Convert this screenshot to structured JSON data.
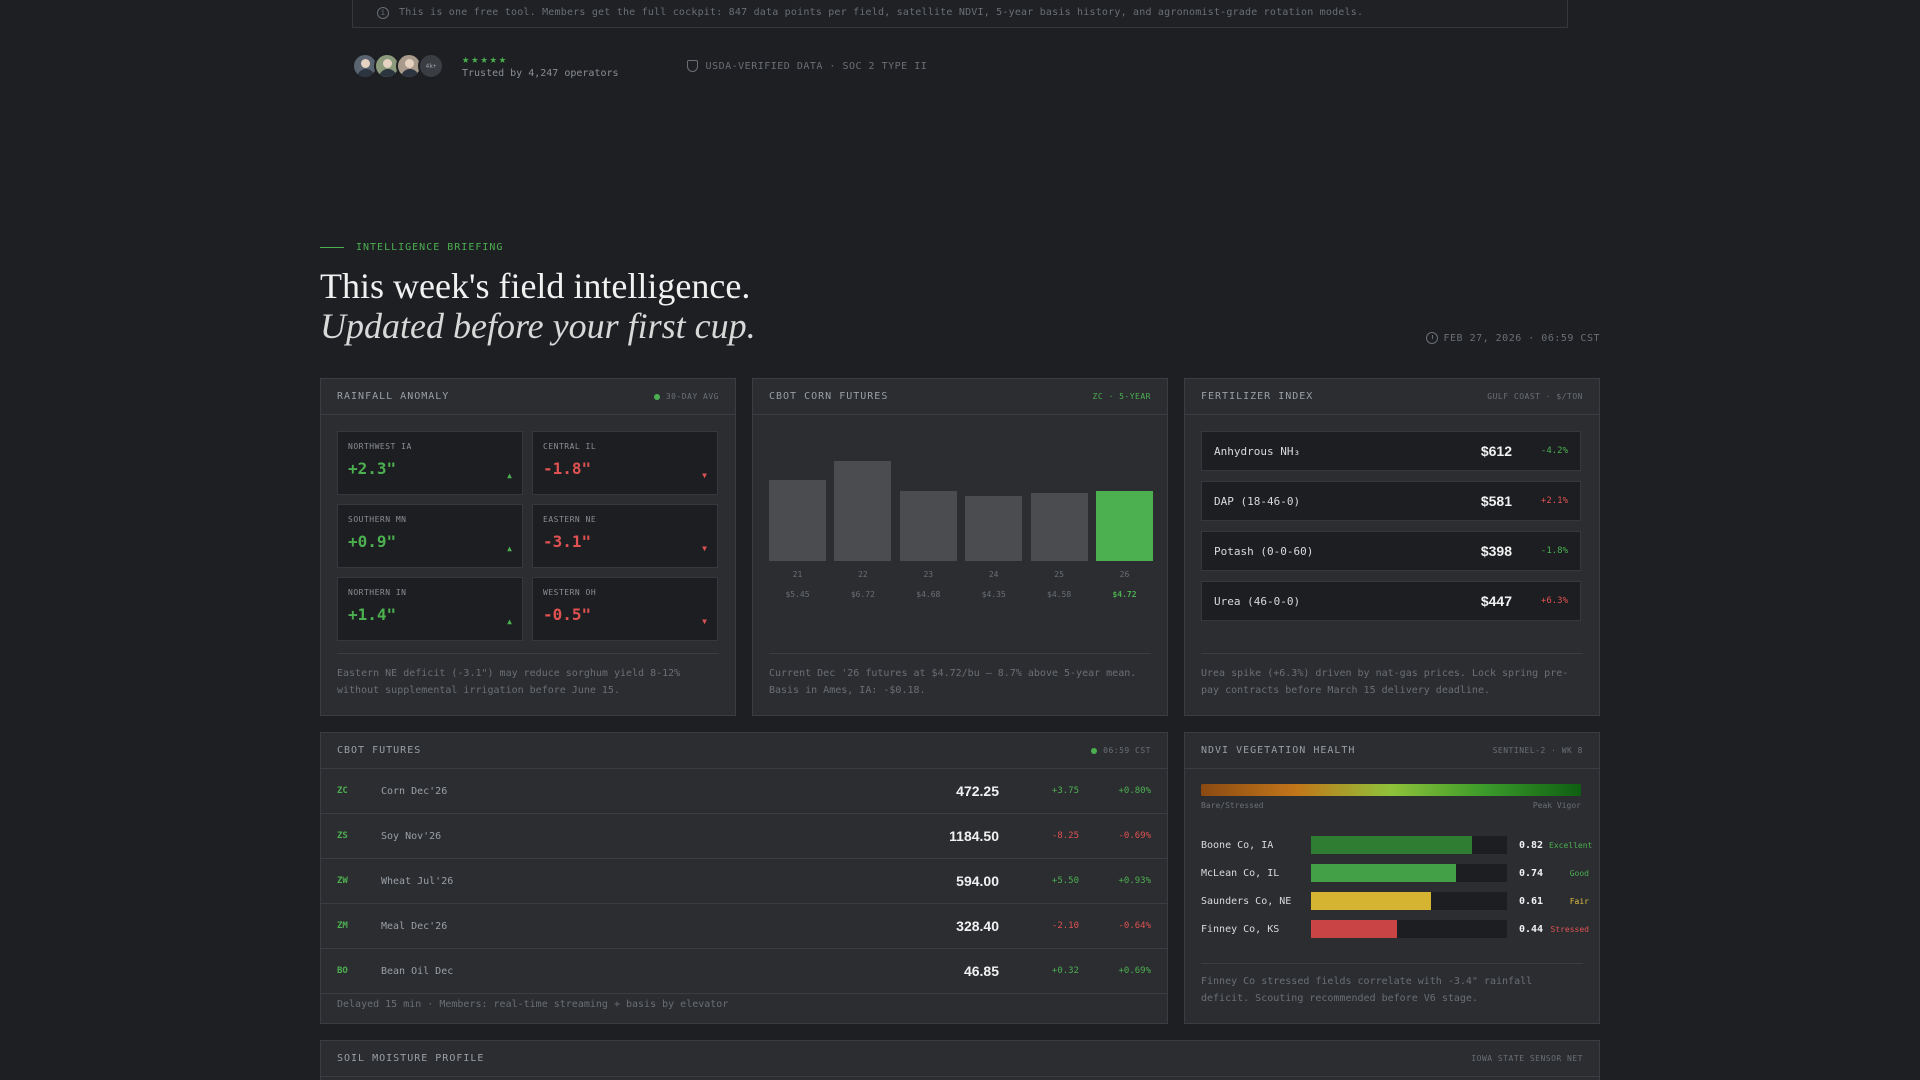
{
  "notice": {
    "text": "This is one free tool. Members get the full cockpit: 847 data points per field, satellite NDVI, 5-year basis history, and agronomist-grade rotation models."
  },
  "trust": {
    "avatar_more": "4k+",
    "stars": "★★★★★",
    "trusted_text": "Trusted by 4,247 operators",
    "verified_text": "USDA-VERIFIED DATA · SOC 2 TYPE II"
  },
  "header": {
    "eyebrow": "INTELLIGENCE BRIEFING",
    "title": "This week's field intelligence.",
    "subtitle": "Updated before your first cup.",
    "datestamp": "FEB 27, 2026 · 06:59 CST"
  },
  "rainfall": {
    "title": "RAINFALL ANOMALY",
    "tag": "30-DAY AVG",
    "regions": [
      {
        "label": "NORTHWEST IA",
        "value": "+2.3\"",
        "dir": "up",
        "arrow": "▲"
      },
      {
        "label": "CENTRAL IL",
        "value": "-1.8\"",
        "dir": "down",
        "arrow": "▼"
      },
      {
        "label": "SOUTHERN MN",
        "value": "+0.9\"",
        "dir": "up",
        "arrow": "▲"
      },
      {
        "label": "EASTERN NE",
        "value": "-3.1\"",
        "dir": "down",
        "arrow": "▼"
      },
      {
        "label": "NORTHERN IN",
        "value": "+1.4\"",
        "dir": "up",
        "arrow": "▲"
      },
      {
        "label": "WESTERN OH",
        "value": "-0.5\"",
        "dir": "down",
        "arrow": "▼"
      }
    ],
    "footnote": "Eastern NE deficit (-3.1\") may reduce sorghum yield 8-12% without supplemental irrigation before June 15."
  },
  "corn": {
    "title": "CBOT CORN FUTURES",
    "tag": "ZC · 5-YEAR",
    "footnote": "Current Dec '26 futures at $4.72/bu — 8.7% above 5-year mean. Basis in Ames, IA: -$0.18."
  },
  "chart_data": {
    "type": "bar",
    "categories": [
      "21",
      "22",
      "23",
      "24",
      "25",
      "26"
    ],
    "values": [
      5.45,
      6.72,
      4.68,
      4.35,
      4.58,
      4.72
    ],
    "price_labels": [
      "$5.45",
      "$6.72",
      "$4.68",
      "$4.35",
      "$4.58",
      "$4.72"
    ],
    "highlight_index": 5,
    "title": "CBOT CORN FUTURES",
    "colors": {
      "default": "#4a4c50",
      "highlight": "#4caf50"
    }
  },
  "fertilizer": {
    "title": "FERTILIZER INDEX",
    "tag": "GULF COAST · $/TON",
    "items": [
      {
        "name": "Anhydrous NH₃",
        "price": "$612",
        "change": "-4.2%",
        "dir": "down"
      },
      {
        "name": "DAP (18-46-0)",
        "price": "$581",
        "change": "+2.1%",
        "dir": "up"
      },
      {
        "name": "Potash (0-0-60)",
        "price": "$398",
        "change": "-1.8%",
        "dir": "down"
      },
      {
        "name": "Urea (46-0-0)",
        "price": "$447",
        "change": "+6.3%",
        "dir": "up"
      }
    ],
    "footnote": "Urea spike (+6.3%) driven by nat-gas prices. Lock spring pre-pay contracts before March 15 delivery deadline."
  },
  "futures": {
    "title": "CBOT FUTURES",
    "tag": "06:59 CST",
    "rows": [
      {
        "sym": "ZC",
        "name": "Corn Dec'26",
        "price": "472.25",
        "chg": "+3.75",
        "pct": "+0.80%",
        "dir": "up"
      },
      {
        "sym": "ZS",
        "name": "Soy Nov'26",
        "price": "1184.50",
        "chg": "-8.25",
        "pct": "-0.69%",
        "dir": "down"
      },
      {
        "sym": "ZW",
        "name": "Wheat Jul'26",
        "price": "594.00",
        "chg": "+5.50",
        "pct": "+0.93%",
        "dir": "up"
      },
      {
        "sym": "ZM",
        "name": "Meal Dec'26",
        "price": "328.40",
        "chg": "-2.10",
        "pct": "-0.64%",
        "dir": "down"
      },
      {
        "sym": "BO",
        "name": "Bean Oil Dec",
        "price": "46.85",
        "chg": "+0.32",
        "pct": "+0.69%",
        "dir": "up"
      }
    ],
    "footnote": "Delayed 15 min · Members: real-time streaming + basis by elevator"
  },
  "ndvi": {
    "title": "NDVI VEGETATION HEALTH",
    "tag": "SENTINEL-2 · WK 8",
    "scale_low": "Bare/Stressed",
    "scale_high": "Peak Vigor",
    "rows": [
      {
        "county": "Boone Co, IA",
        "value": "0.82",
        "level": 0.82,
        "status": "Excellent",
        "color": "#2e7d32",
        "status_color": "#4caf50"
      },
      {
        "county": "McLean Co, IL",
        "value": "0.74",
        "level": 0.74,
        "status": "Good",
        "color": "#43a047",
        "status_color": "#4caf50"
      },
      {
        "county": "Saunders Co, NE",
        "value": "0.61",
        "level": 0.61,
        "status": "Fair",
        "color": "#d4b430",
        "status_color": "#e0c040"
      },
      {
        "county": "Finney Co, KS",
        "value": "0.44",
        "level": 0.44,
        "status": "Stressed",
        "color": "#c94444",
        "status_color": "#e05252"
      }
    ],
    "footnote": "Finney Co stressed fields correlate with -3.4\" rainfall deficit. Scouting recommended before V6 stage."
  },
  "soil": {
    "title": "SOIL MOISTURE PROFILE",
    "tag": "IOWA STATE SENSOR NET"
  }
}
